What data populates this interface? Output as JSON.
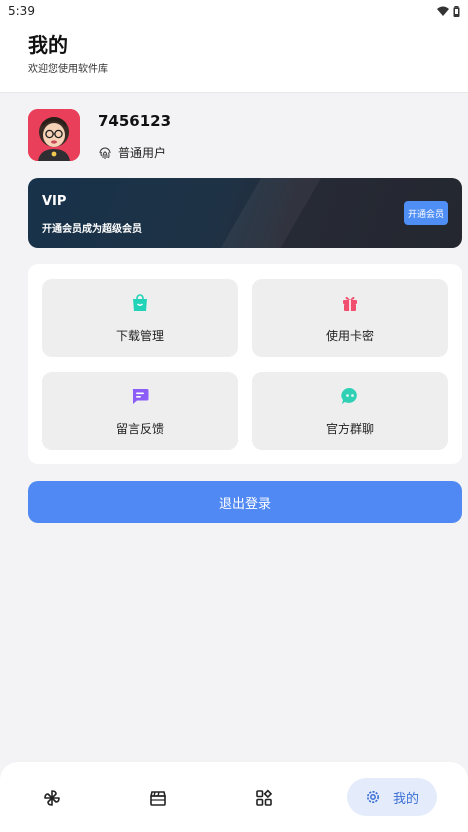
{
  "status_bar": {
    "time": "5:39"
  },
  "header": {
    "title": "我的",
    "subtitle": "欢迎您使用软件库"
  },
  "profile": {
    "username": "7456123",
    "level": "普通用户"
  },
  "vip": {
    "title": "VIP",
    "description": "开通会员成为超级会员",
    "button": "开通会员"
  },
  "menu": {
    "items": [
      {
        "label": "下载管理",
        "icon": "shopping-bag-icon",
        "color": "#23d3b8"
      },
      {
        "label": "使用卡密",
        "icon": "gift-icon",
        "color": "#f0506e"
      },
      {
        "label": "留言反馈",
        "icon": "message-icon",
        "color": "#8b5cf6"
      },
      {
        "label": "官方群聊",
        "icon": "chat-bubble-icon",
        "color": "#2fd0b4"
      }
    ]
  },
  "logout": {
    "label": "退出登录"
  },
  "bottom_nav": {
    "items": [
      {
        "icon": "pinwheel-icon"
      },
      {
        "icon": "clapperboard-icon"
      },
      {
        "icon": "apps-icon"
      },
      {
        "icon": "gear-icon",
        "label": "我的",
        "active": true
      }
    ]
  },
  "colors": {
    "accent": "#5089f3",
    "vip_button": "#4f8ef5",
    "nav_active_bg": "#e4ecfb"
  }
}
